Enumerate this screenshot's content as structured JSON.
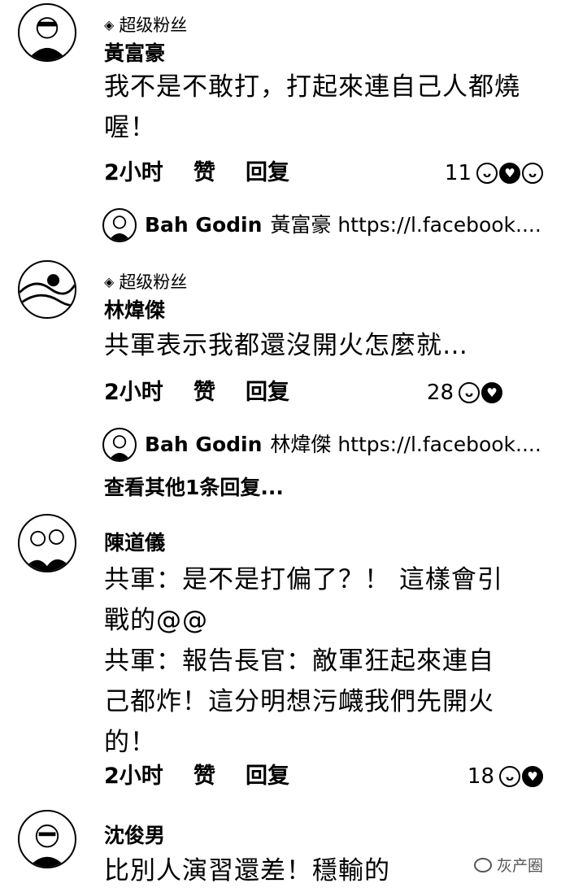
{
  "comments": [
    {
      "badge": "超级粉丝",
      "author": "黃富豪",
      "text": "我不是不敢打，打起來連自己人都燒喔！",
      "time": "2小时",
      "like": "赞",
      "reply": "回复",
      "reaction_count": "11",
      "reactions": [
        "haha-icon",
        "care-icon",
        "laugh-tears-icon"
      ],
      "linked_reply": {
        "name": "Bah Godin",
        "text": "黃富豪 https://l.facebook...."
      }
    },
    {
      "badge": "超级粉丝",
      "author": "林煒傑",
      "text": "共軍表示我都還沒開火怎麼就…",
      "time": "2小时",
      "like": "赞",
      "reply": "回复",
      "reaction_count": "28",
      "reactions": [
        "haha-icon",
        "care-icon"
      ],
      "linked_reply": {
        "name": "Bah Godin",
        "text": "林煒傑 https://l.facebook...."
      },
      "view_more": "查看其他1条回复..."
    },
    {
      "author": "陳道儀",
      "text_lines": [
        "共軍：是不是打偏了？！ 這樣會引",
        "戰的@@",
        "共軍：報告長官：敵軍狂起來連自",
        "己都炸！這分明想污衊我們先開火",
        "的！"
      ],
      "time": "2小时",
      "like": "赞",
      "reply": "回复",
      "reaction_count": "18",
      "reactions": [
        "haha-icon",
        "care-icon"
      ]
    },
    {
      "author": "沈俊男",
      "text": "比別人演習還差！穩輸的"
    }
  ],
  "watermark": "灰产圈"
}
